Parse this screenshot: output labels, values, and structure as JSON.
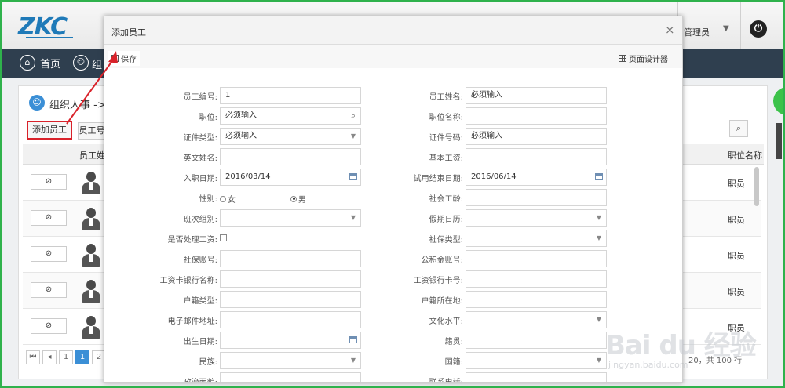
{
  "app": {
    "logo": "ZKC",
    "admin_name": "管理员",
    "nav_home": "首页",
    "nav_org_partial": "组",
    "breadcrumb": "组织人事 ->",
    "add_employee_button": "添加员工",
    "emp_no_button": "员工号",
    "col_name_header": "员工姓",
    "col_position_header": "职位名称",
    "row_position": "职员",
    "rows": [
      {
        "pos": "职员"
      },
      {
        "pos": "职员"
      },
      {
        "pos": "职员"
      },
      {
        "pos": "职员"
      },
      {
        "pos": "职员"
      }
    ],
    "pager": [
      "1",
      "1",
      "2"
    ],
    "pager_info": "20，共 100 行"
  },
  "modal": {
    "title": "添加员工",
    "close": "×",
    "save_label": "保存",
    "designer_label": "页面设计器"
  },
  "form": {
    "left": [
      {
        "label": "员工编号:",
        "value": "1",
        "type": "text"
      },
      {
        "label": "职位:",
        "value": "必须输入",
        "type": "search"
      },
      {
        "label": "证件类型:",
        "value": "必须输入",
        "type": "select"
      },
      {
        "label": "英文姓名:",
        "value": "",
        "type": "text"
      },
      {
        "label": "入职日期:",
        "value": "2016/03/14",
        "type": "date"
      },
      {
        "label": "性别:",
        "type": "radio",
        "options": [
          "女",
          "男"
        ],
        "selected": "男"
      },
      {
        "label": "班次组别:",
        "value": "",
        "type": "select"
      },
      {
        "label": "是否处理工资:",
        "type": "checkbox"
      },
      {
        "label": "社保账号:",
        "value": "",
        "type": "text"
      },
      {
        "label": "工资卡银行名称:",
        "value": "",
        "type": "text"
      },
      {
        "label": "户籍类型:",
        "value": "",
        "type": "text"
      },
      {
        "label": "电子邮件地址:",
        "value": "",
        "type": "text"
      },
      {
        "label": "出生日期:",
        "value": "",
        "type": "date"
      },
      {
        "label": "民族:",
        "value": "",
        "type": "select"
      },
      {
        "label": "政治面貌:",
        "value": "",
        "type": "text"
      }
    ],
    "right": [
      {
        "label": "员工姓名:",
        "value": "必须输入",
        "type": "text"
      },
      {
        "label": "职位名称:",
        "value": "",
        "type": "text"
      },
      {
        "label": "证件号码:",
        "value": "必须输入",
        "type": "text"
      },
      {
        "label": "基本工资:",
        "value": "",
        "type": "text"
      },
      {
        "label": "试用结束日期:",
        "value": "2016/06/14",
        "type": "date"
      },
      {
        "label": "社会工龄:",
        "value": "",
        "type": "text"
      },
      {
        "label": "假期日历:",
        "value": "",
        "type": "select"
      },
      {
        "label": "社保类型:",
        "value": "",
        "type": "select"
      },
      {
        "label": "公积金账号:",
        "value": "",
        "type": "text"
      },
      {
        "label": "工资银行卡号:",
        "value": "",
        "type": "text"
      },
      {
        "label": "户籍所在地:",
        "value": "",
        "type": "text"
      },
      {
        "label": "文化水平:",
        "value": "",
        "type": "select"
      },
      {
        "label": "籍贯:",
        "value": "",
        "type": "text"
      },
      {
        "label": "国籍:",
        "value": "",
        "type": "select"
      },
      {
        "label": "联系电话:",
        "value": "",
        "type": "text"
      }
    ]
  },
  "watermark": {
    "text": "Bai du 经验",
    "sub": "jingyan.baidu.com"
  },
  "colors": {
    "frame": "#2fb24c",
    "navbar": "#2f3f4f",
    "accent": "#3b8fd6",
    "annotation": "#d9222a"
  }
}
